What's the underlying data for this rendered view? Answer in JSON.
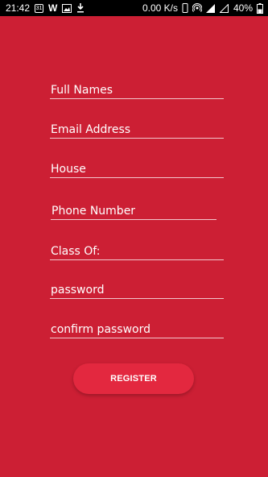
{
  "status_bar": {
    "time": "21:42",
    "calendar_day": "31",
    "network_speed": "0.00 K/s",
    "battery_percent": "40%"
  },
  "form": {
    "fields": [
      {
        "label": "Full Names"
      },
      {
        "label": "Email Address"
      },
      {
        "label": "House"
      },
      {
        "label": "Phone Number"
      },
      {
        "label": "Class Of:"
      },
      {
        "label": "password"
      },
      {
        "label": "confirm password"
      }
    ],
    "register_label": "REGISTER"
  },
  "colors": {
    "background": "#cc1f34",
    "button": "#e3283f",
    "text": "#ffffff"
  }
}
